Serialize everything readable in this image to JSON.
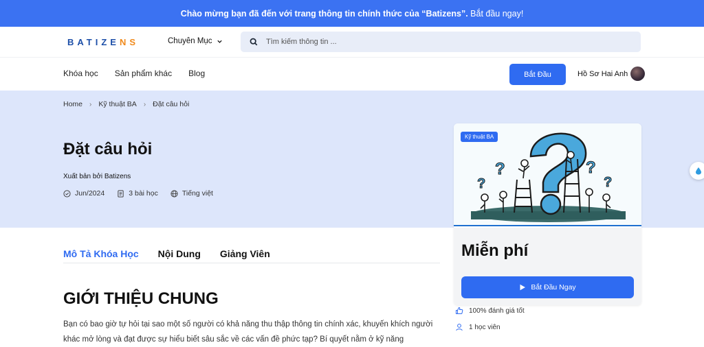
{
  "banner": {
    "text": "Chào mừng bạn đã đến với trang thông tin chính thức của “Batizens”.",
    "cta": "Bắt đầu ngay!"
  },
  "header": {
    "logo_main": "BATIZENS",
    "category_label": "Chuyên Mục",
    "search_placeholder": "Tìm kiếm thông tin ...",
    "nav": [
      "Khóa học",
      "Sản phẩm khác",
      "Blog"
    ],
    "start_button": "Bắt Đầu",
    "profile_name": "Hồ Sơ Hai Anh"
  },
  "breadcrumb": [
    "Home",
    "Kỹ thuật BA",
    "Đặt câu hỏi"
  ],
  "course": {
    "title": "Đặt câu hỏi",
    "author": "Xuất bản bởi Batizens",
    "date": "Jun/2024",
    "lessons": "3 bài học",
    "language": "Tiếng việt"
  },
  "card": {
    "tag": "Kỹ thuật BA",
    "price": "Miễn phí",
    "button": "Bắt Đầu Ngay",
    "rating": "100% đánh giá tốt",
    "students": "1 học viên"
  },
  "tabs": [
    "Mô Tả Khóa Học",
    "Nội Dung",
    "Giảng Viên"
  ],
  "section": {
    "heading": "GIỚI THIỆU CHUNG",
    "paragraph": "Bạn có bao giờ tự hỏi tại sao một số người có khả năng thu thập thông tin chính xác, khuyến khích người khác mở lòng và đạt được sự hiểu biết sâu sắc về các vấn đề phức tạp? Bí quyết nằm ở kỹ năng"
  },
  "colors": {
    "primary": "#2f6bf1",
    "banner": "#3b72f2",
    "hero_bg": "#dde6fb",
    "logo_accent": "#f08a1c"
  }
}
